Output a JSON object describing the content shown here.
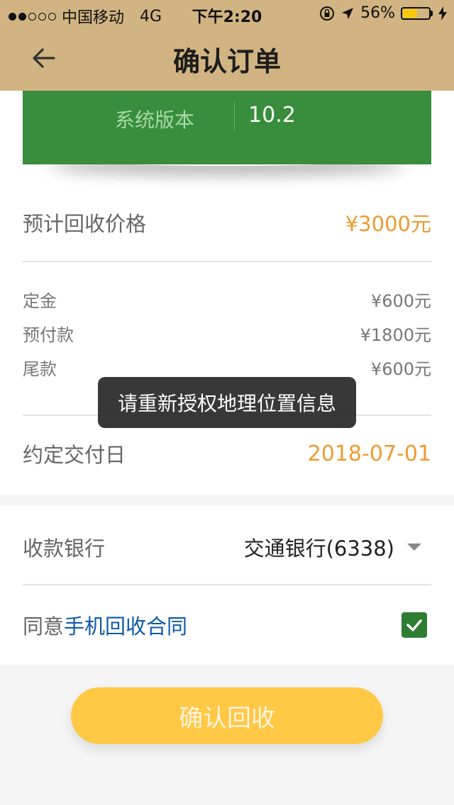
{
  "status_bar": {
    "carrier": "中国移动",
    "network": "4G",
    "time": "下午2:20",
    "battery": "56%",
    "battery_fraction": 0.56
  },
  "nav": {
    "title": "确认订单"
  },
  "device_card": {
    "label": "系统版本",
    "value": "10.2"
  },
  "price": {
    "label": "预计回收价格",
    "value": "¥3000元"
  },
  "payments": [
    {
      "label": "定金",
      "value": "¥600元"
    },
    {
      "label": "预付款",
      "value": "¥1800元"
    },
    {
      "label": "尾款",
      "value": "¥600元"
    }
  ],
  "toast": {
    "text": "请重新授权地理位置信息"
  },
  "delivery": {
    "label": "约定交付日",
    "value": "2018-07-01"
  },
  "bank": {
    "label": "收款银行",
    "value": "交通银行(6338)"
  },
  "agreement": {
    "prefix": "同意",
    "link": "手机回收合同",
    "checked": true
  },
  "confirm_button": {
    "label": "确认回收"
  },
  "colors": {
    "header_bg": "#d2b482",
    "card_green": "#388e3c",
    "accent_orange": "#f09a2e",
    "link_blue": "#0e5aa7",
    "button_yellow": "#ffc845"
  }
}
